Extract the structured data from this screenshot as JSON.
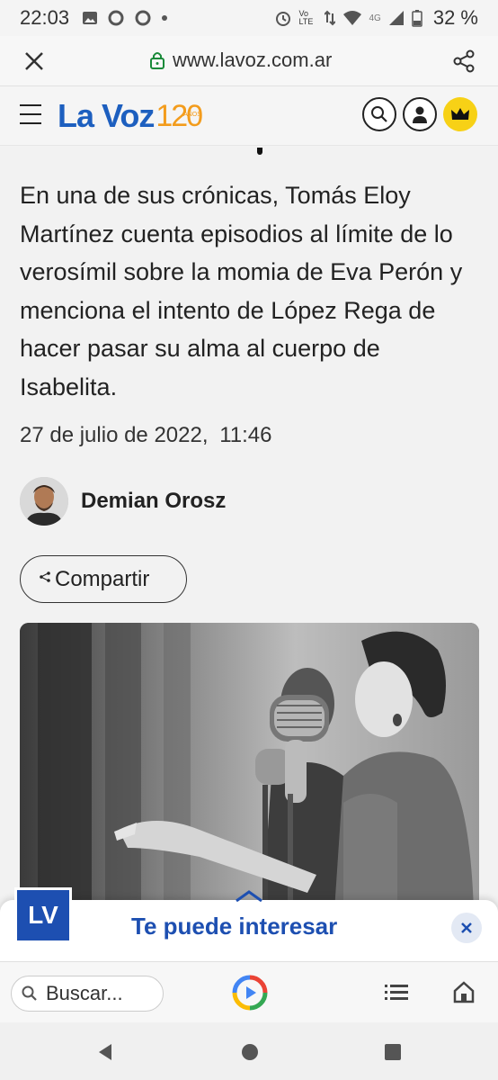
{
  "status_bar": {
    "time": "22:03",
    "network_label": "Vo LTE",
    "network_type": "4G",
    "battery": "32 %"
  },
  "browser": {
    "url": "www.lavoz.com.ar",
    "icons": [
      "close-icon",
      "lock-icon",
      "share-icon"
    ]
  },
  "site_header": {
    "logo_text": "La Voz",
    "anniversary_text": "120",
    "anniversary_sub": "AÑOS",
    "brand_color": "#1d5fbf",
    "accent_color": "#f39c1c",
    "crown_color": "#f7d116"
  },
  "article": {
    "lead": "En una de sus crónicas, Tomás Eloy Martínez cuenta episodios al límite de lo verosímil sobre la momia de Eva Perón y menciona el intento de López Rega de hacer pasar su alma al cuerpo de Isabelita.",
    "date": "27 de julio de 2022,",
    "time": "11:46",
    "author": "Demian Orosz",
    "share_label": "Compartir"
  },
  "suggestion_bar": {
    "badge": "LV",
    "title": "Te puede interesar",
    "color": "#1d4fb1"
  },
  "google_bar": {
    "search_placeholder": "Buscar..."
  },
  "nav": {
    "icons": [
      "back-icon",
      "home-icon",
      "recents-icon"
    ]
  }
}
